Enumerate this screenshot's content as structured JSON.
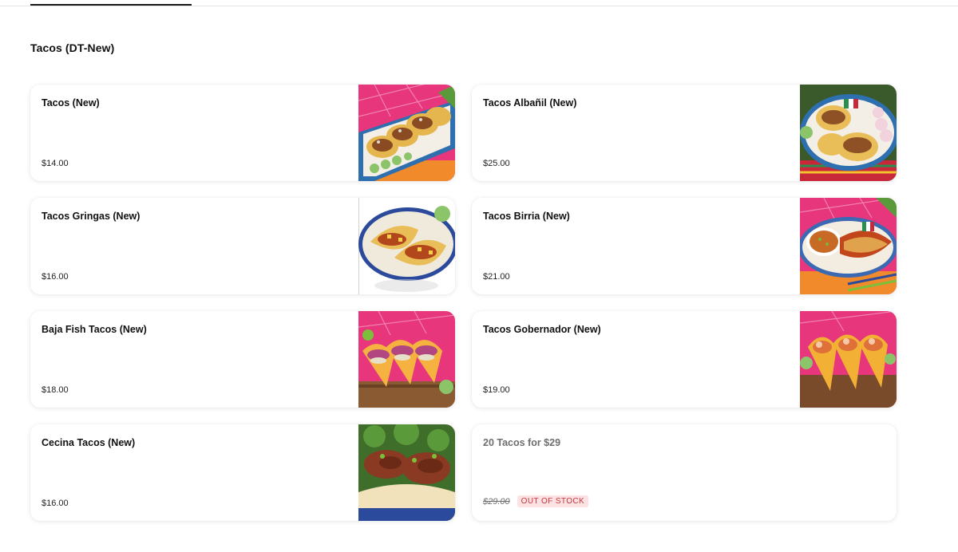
{
  "section": {
    "title": "Tacos (DT-New)"
  },
  "items": [
    {
      "name": "Tacos (New)",
      "price": "$14.00",
      "image": "tacos-platter"
    },
    {
      "name": "Tacos Albañil (New)",
      "price": "$25.00",
      "image": "tacos-albanil"
    },
    {
      "name": "Tacos Gringas (New)",
      "price": "$16.00",
      "image": "tacos-gringas"
    },
    {
      "name": "Tacos Birria (New)",
      "price": "$21.00",
      "image": "tacos-birria"
    },
    {
      "name": "Baja Fish Tacos (New)",
      "price": "$18.00",
      "image": "fish-tacos"
    },
    {
      "name": "Tacos Gobernador (New)",
      "price": "$19.00",
      "image": "tacos-gobernador"
    },
    {
      "name": "Cecina Tacos (New)",
      "price": "$16.00",
      "image": "cecina-tacos"
    }
  ],
  "promo": {
    "name": "20 Tacos for $29",
    "price": "$29.00",
    "badge": "OUT OF STOCK"
  },
  "colors": {
    "accent": "#111111",
    "oos_text": "#c4363f",
    "oos_bg": "#fde2e4",
    "muted": "#6e6e6e"
  }
}
